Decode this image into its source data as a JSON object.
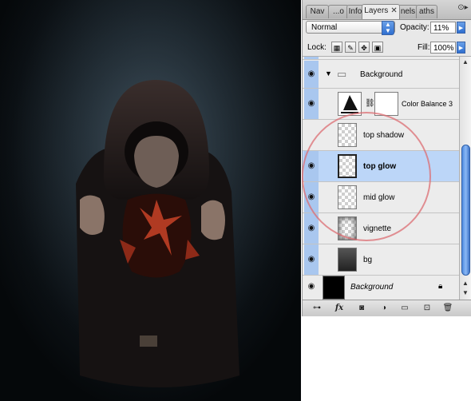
{
  "colors": {
    "selection": "#bcd6f8",
    "eye_column": "#a9c7ef",
    "annotation": "#dc6e73"
  },
  "tabs": [
    {
      "label": "Nav",
      "active": false
    },
    {
      "label": "...o",
      "active": false
    },
    {
      "label": "Info",
      "active": false
    },
    {
      "label": "Layers",
      "active": true
    },
    {
      "label": "nels",
      "active": false
    },
    {
      "label": "aths",
      "active": false
    }
  ],
  "blend_mode": "Normal",
  "opacity_label": "Opacity:",
  "opacity_value": "11%",
  "lock_label": "Lock:",
  "fill_label": "Fill:",
  "fill_value": "100%",
  "layers": [
    {
      "name": "Background",
      "kind": "group",
      "visible": true,
      "selected": false
    },
    {
      "name": "Color Balance 3",
      "kind": "adjustment",
      "visible": true,
      "selected": false
    },
    {
      "name": "top shadow",
      "kind": "layer",
      "visible": false,
      "selected": false
    },
    {
      "name": "top glow",
      "kind": "layer",
      "visible": true,
      "selected": true
    },
    {
      "name": "mid glow",
      "kind": "layer",
      "visible": true,
      "selected": false
    },
    {
      "name": "vignette",
      "kind": "layer",
      "visible": true,
      "selected": false
    },
    {
      "name": "bg",
      "kind": "layer",
      "visible": true,
      "selected": false
    },
    {
      "name": "Background",
      "kind": "background",
      "visible": true,
      "selected": false
    }
  ],
  "bottom_icons": [
    "link-icon",
    "fx-icon",
    "mask-icon",
    "adjustment-icon",
    "folder-icon",
    "new-layer-icon",
    "trash-icon"
  ]
}
